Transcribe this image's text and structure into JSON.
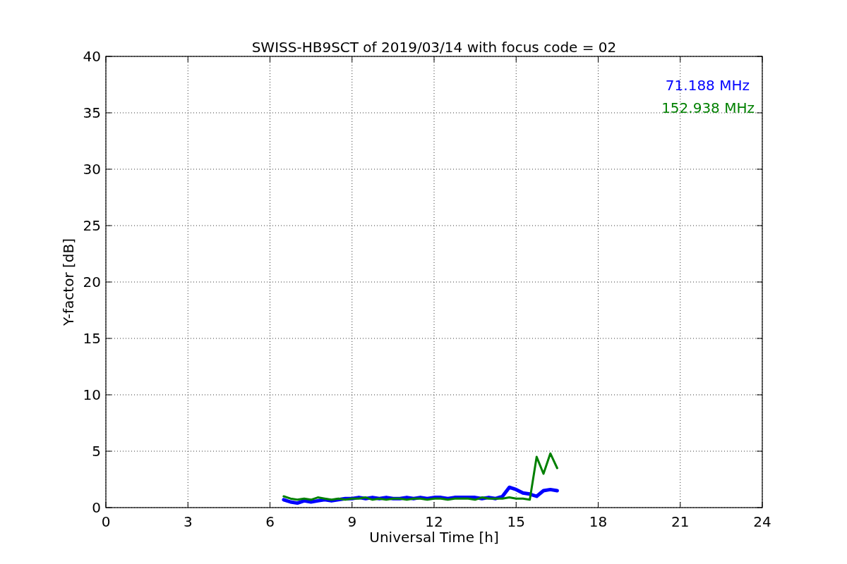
{
  "chart_data": {
    "type": "line",
    "title": "SWISS-HB9SCT of 2019/03/14 with focus code = 02",
    "xlabel": "Universal Time [h]",
    "ylabel": "Y-factor [dB]",
    "x": [
      6.5,
      6.75,
      7,
      7.25,
      7.5,
      7.75,
      8,
      8.25,
      8.5,
      8.75,
      9,
      9.25,
      9.5,
      9.75,
      10,
      10.25,
      10.5,
      10.75,
      11,
      11.25,
      11.5,
      11.75,
      12,
      12.25,
      12.5,
      12.75,
      13,
      13.25,
      13.5,
      13.75,
      14,
      14.25,
      14.5,
      14.75,
      15,
      15.25,
      15.5,
      15.75,
      16,
      16.25,
      16.5
    ],
    "series": [
      {
        "name": "71.188 MHz",
        "color": "#0000ff",
        "values": [
          0.7,
          0.5,
          0.4,
          0.6,
          0.5,
          0.6,
          0.7,
          0.6,
          0.7,
          0.8,
          0.8,
          0.9,
          0.8,
          0.9,
          0.8,
          0.9,
          0.8,
          0.8,
          0.9,
          0.8,
          0.9,
          0.8,
          0.9,
          0.9,
          0.8,
          0.9,
          0.9,
          0.9,
          0.9,
          0.8,
          0.9,
          0.8,
          1.0,
          1.8,
          1.6,
          1.3,
          1.2,
          1.0,
          1.5,
          1.6,
          1.5
        ]
      },
      {
        "name": "152.938 MHz",
        "color": "#008000",
        "values": [
          1.0,
          0.8,
          0.7,
          0.8,
          0.7,
          0.9,
          0.8,
          0.7,
          0.8,
          0.7,
          0.8,
          0.8,
          0.9,
          0.7,
          0.8,
          0.7,
          0.8,
          0.8,
          0.7,
          0.8,
          0.8,
          0.7,
          0.8,
          0.8,
          0.7,
          0.8,
          0.8,
          0.8,
          0.7,
          0.9,
          0.8,
          0.8,
          0.8,
          0.9,
          0.8,
          0.8,
          0.7,
          4.5,
          3.0,
          4.8,
          3.5
        ]
      }
    ],
    "xlim": [
      0,
      24
    ],
    "ylim": [
      0,
      40
    ],
    "xticks": [
      0,
      3,
      6,
      9,
      12,
      15,
      18,
      21,
      24
    ],
    "yticks": [
      0,
      5,
      10,
      15,
      20,
      25,
      30,
      35,
      40
    ],
    "grid": true
  }
}
